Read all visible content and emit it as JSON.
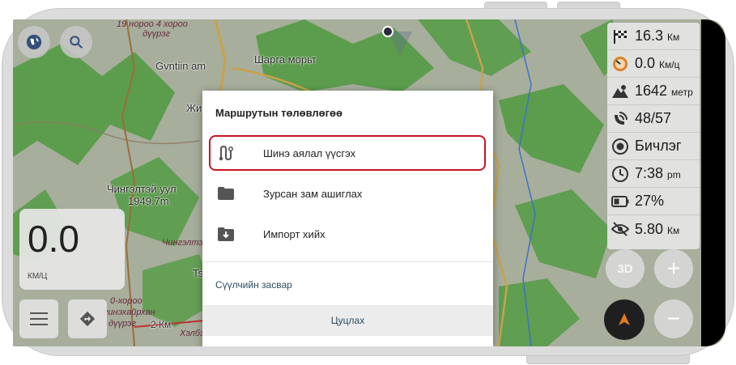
{
  "map": {
    "labels": {
      "l1": "19 нороо 4 хороо",
      "l2": "дүүрэг",
      "l3": "Gvntiin am",
      "l4": "Шарга морьт",
      "l5": "Жи",
      "l6": "Чингэлтэй уул",
      "l7": "1949.7m",
      "l8": "Чингэлтэй",
      "l9": "Ts",
      "l10": "0-хороо",
      "l11": "гинэхайрхан",
      "l12": "дүүрэг",
      "l13": "2 Км",
      "l14": "Хэлбэ"
    }
  },
  "map_controls": {
    "globe_icon": "globe-icon",
    "search_icon": "search-icon",
    "menu_icon": "menu-icon",
    "directions_icon": "directions-icon"
  },
  "speed_widget": {
    "value": "0.0",
    "unit": "КМ/Ц"
  },
  "info_panel": {
    "rows": [
      {
        "icon": "finish-flag-icon",
        "value": "16.3",
        "unit": "Км"
      },
      {
        "icon": "speedometer-icon",
        "value": "0.0",
        "unit": "Км/ц"
      },
      {
        "icon": "altitude-icon",
        "value": "1642",
        "unit": "метр"
      },
      {
        "icon": "gps-satellite-icon",
        "value": "48/57",
        "unit": ""
      },
      {
        "icon": "record-icon",
        "value": "Бичлэг",
        "unit": ""
      },
      {
        "icon": "clock-icon",
        "value": "7:38",
        "unit": "pm"
      },
      {
        "icon": "battery-icon",
        "value": "27%",
        "unit": ""
      },
      {
        "icon": "visibility-icon",
        "value": "5.80",
        "unit": "Км"
      }
    ]
  },
  "right_controls": {
    "btn_3d": "3D",
    "zoom_in": "+",
    "zoom_out": "−"
  },
  "dialog": {
    "title": "Маршрутын төлөвлөгөө",
    "items": [
      {
        "icon": "route-icon",
        "label": "Шинэ аялал үүсгэх"
      },
      {
        "icon": "folder-icon",
        "label": "Зурсан зам ашиглах"
      },
      {
        "icon": "import-icon",
        "label": "Импорт хийх"
      }
    ],
    "edit_link": "Сүүлчийн засвар",
    "cancel": "Цуцлах"
  },
  "colors": {
    "highlight": "#c6151f",
    "forest": "#4f9a3f",
    "terrain": "#9aa68d",
    "nav_arrow": "#e07b1c"
  }
}
